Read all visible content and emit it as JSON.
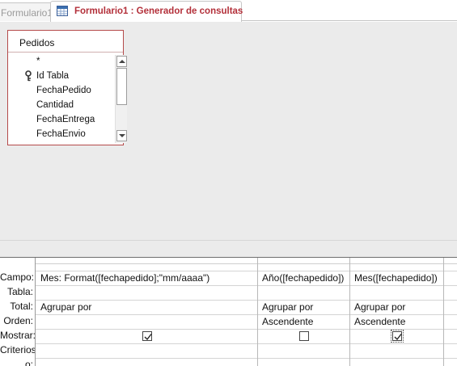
{
  "tabs": [
    {
      "label": "Formulario1",
      "active": false
    },
    {
      "label": "Formulario1 : Generador de consultas",
      "active": true
    }
  ],
  "table": {
    "title": "Pedidos",
    "fields": [
      {
        "name": "*",
        "key": false
      },
      {
        "name": "Id Tabla",
        "key": true
      },
      {
        "name": "FechaPedido",
        "key": false
      },
      {
        "name": "Cantidad",
        "key": false
      },
      {
        "name": "FechaEntrega",
        "key": false
      },
      {
        "name": "FechaEnvio",
        "key": false
      }
    ]
  },
  "grid": {
    "row_labels": [
      "Campo:",
      "Tabla:",
      "Total:",
      "Orden:",
      "Mostrar:",
      "Criterios:",
      "o:"
    ],
    "columns": [
      {
        "campo": "Mes: Format([fechapedido];\"mm/aaaa\")",
        "tabla": "",
        "total": "Agrupar por",
        "orden": "",
        "mostrar": true
      },
      {
        "campo": "Año([fechapedido])",
        "tabla": "",
        "total": "Agrupar por",
        "orden": "Ascendente",
        "mostrar": false
      },
      {
        "campo": "Mes([fechapedido])",
        "tabla": "",
        "total": "Agrupar por",
        "orden": "Ascendente",
        "mostrar": true
      }
    ]
  },
  "colors": {
    "active_tab_text": "#b3303a",
    "table_border": "#b54a4a",
    "design_background": "#ebebeb"
  },
  "icons": {
    "tab": "query-designer-icon",
    "key": "primary-key-icon",
    "scroll_up": "chevron-up-icon",
    "scroll_down": "chevron-down-icon",
    "checked": "checkmark-icon"
  }
}
